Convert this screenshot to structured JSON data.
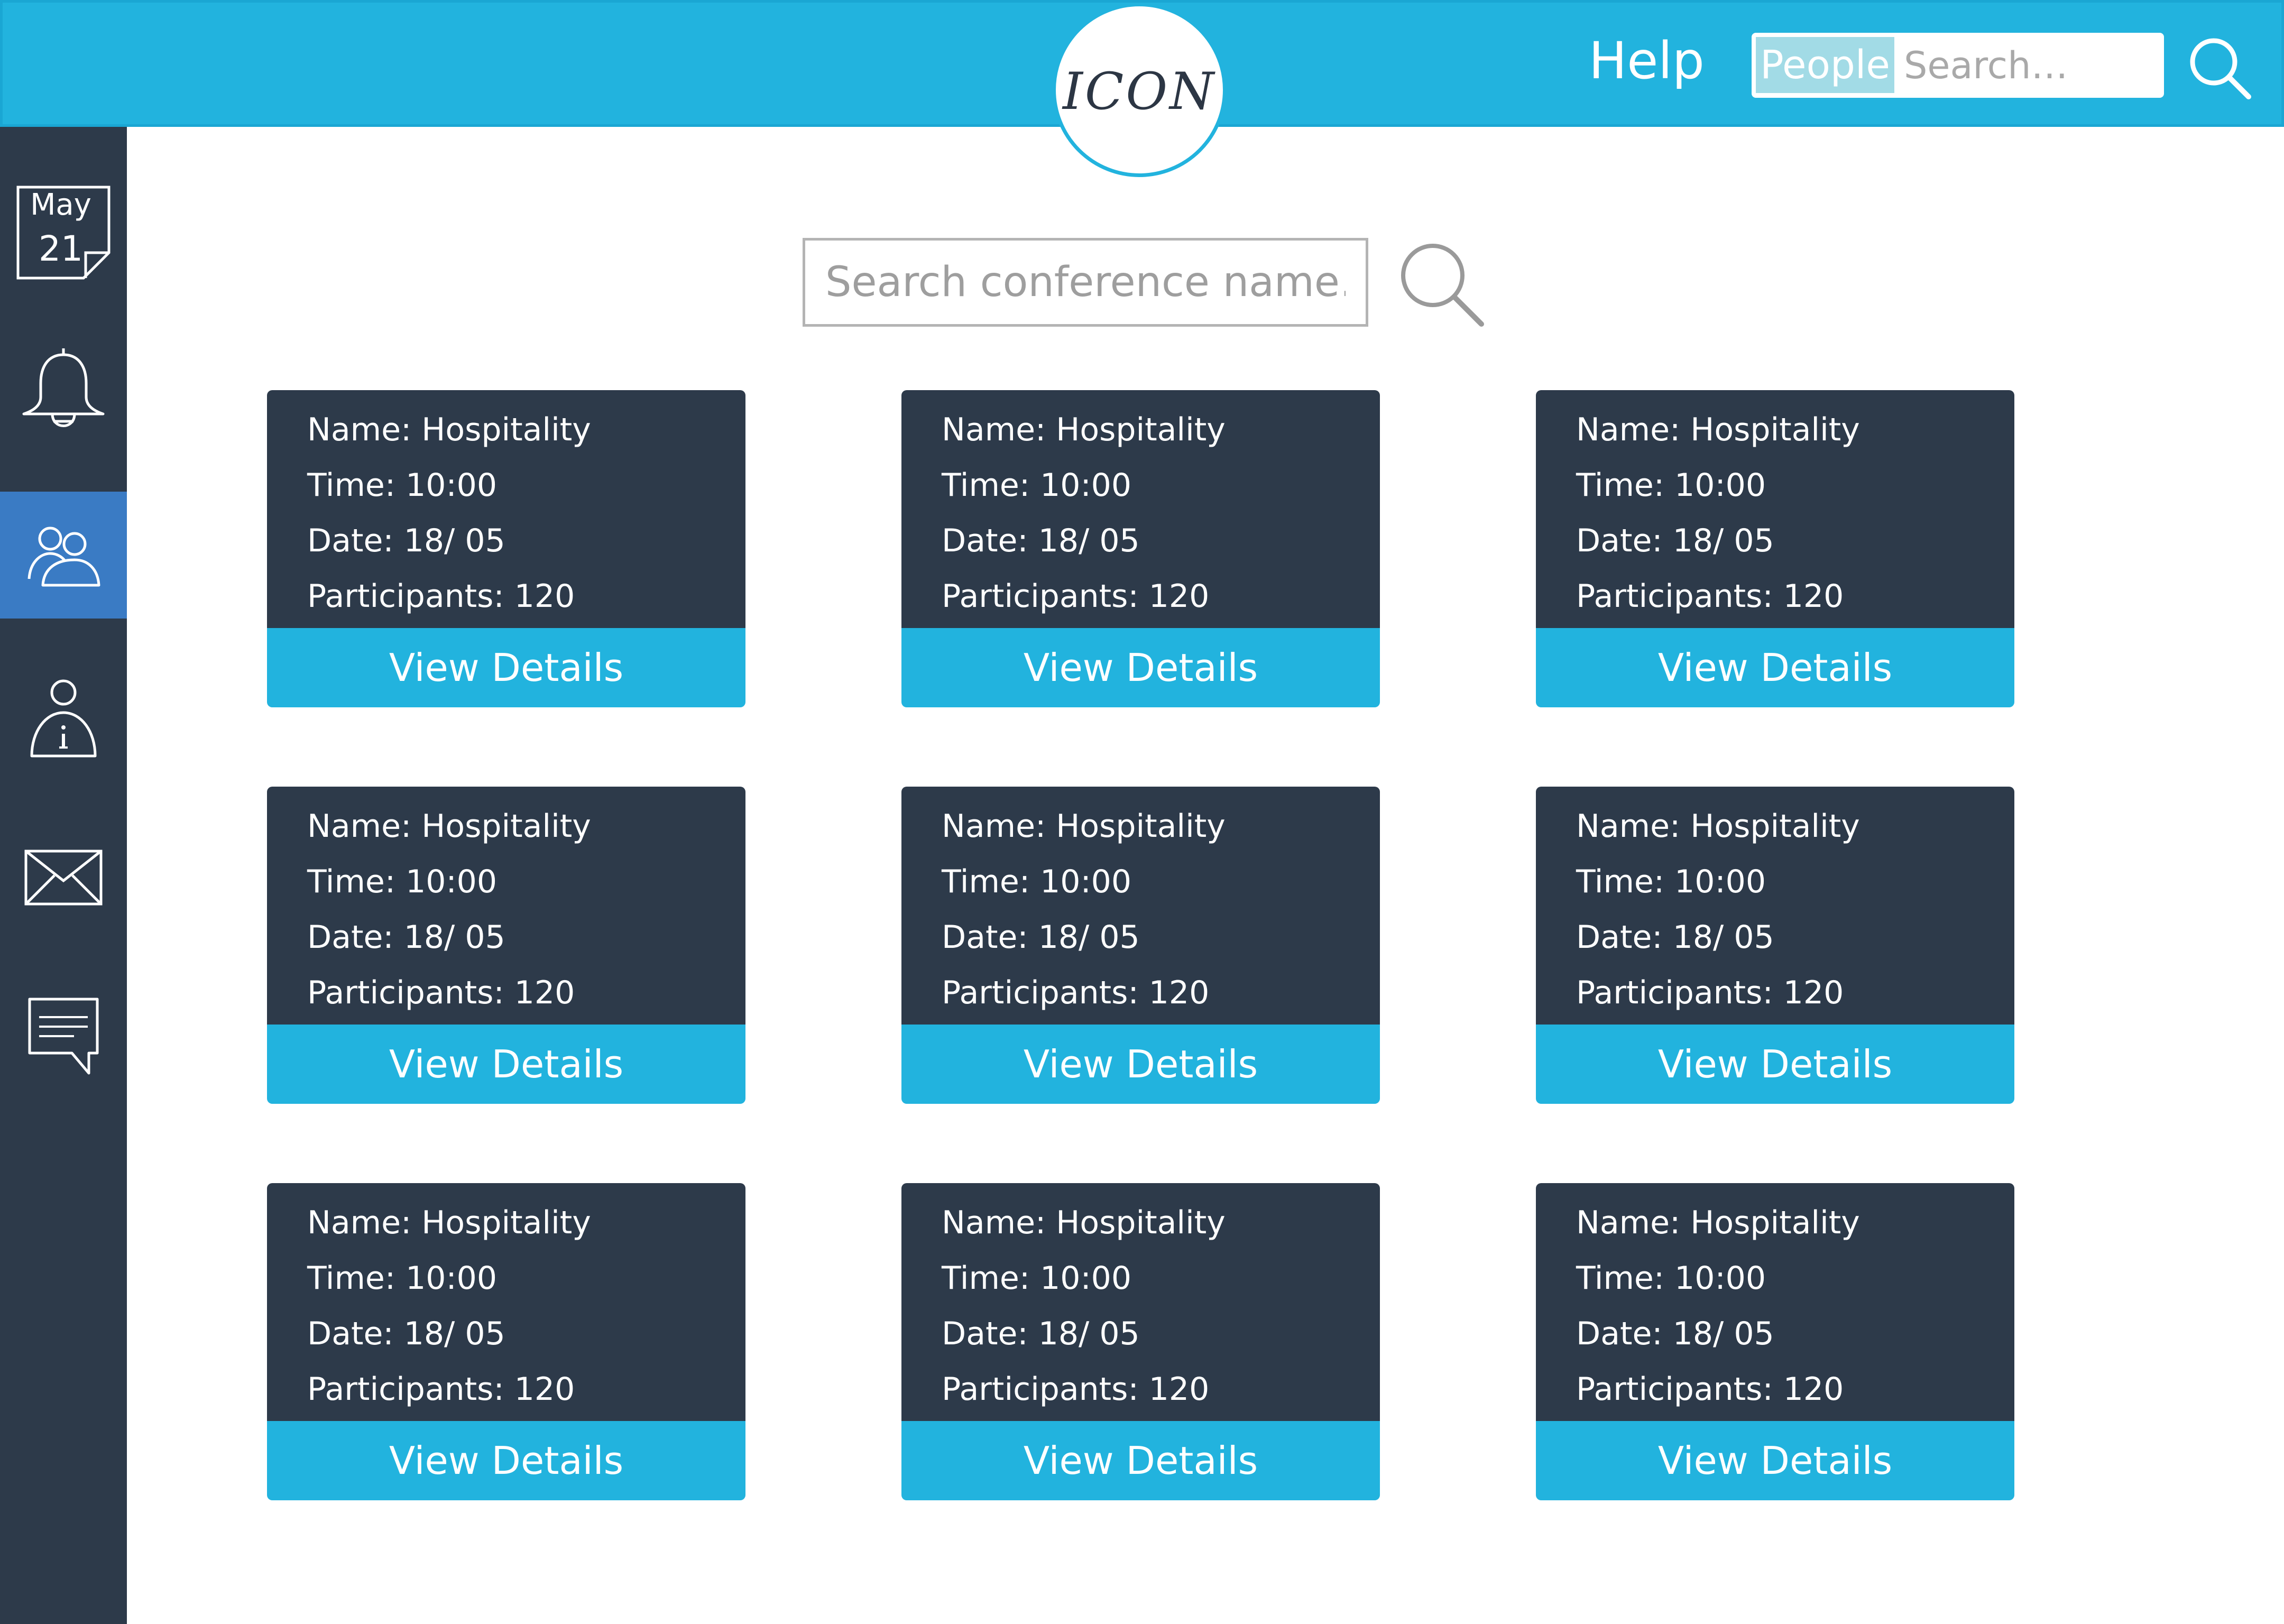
{
  "header": {
    "logo_text": "ICON",
    "help_label": "Help",
    "people_chip": "People",
    "search_placeholder": "Search…"
  },
  "sidebar": {
    "calendar": {
      "month": "May",
      "day": "21"
    },
    "items": [
      {
        "name": "calendar",
        "icon": "calendar-icon"
      },
      {
        "name": "notifications",
        "icon": "bell-icon"
      },
      {
        "name": "people",
        "icon": "people-icon",
        "active": true
      },
      {
        "name": "info",
        "icon": "user-info-icon"
      },
      {
        "name": "mail",
        "icon": "mail-icon"
      },
      {
        "name": "messages",
        "icon": "chat-icon"
      }
    ]
  },
  "main": {
    "conference_search_placeholder": "Search conference name…",
    "cards": [
      {
        "name": "Name: Hospitality",
        "time": "Time: 10:00",
        "date": "Date: 18/ 05",
        "participants": "Participants: 120",
        "button": "View Details"
      },
      {
        "name": "Name: Hospitality",
        "time": "Time: 10:00",
        "date": "Date: 18/ 05",
        "participants": "Participants: 120",
        "button": "View Details"
      },
      {
        "name": "Name: Hospitality",
        "time": "Time: 10:00",
        "date": "Date: 18/ 05",
        "participants": "Participants: 120",
        "button": "View Details"
      },
      {
        "name": "Name: Hospitality",
        "time": "Time: 10:00",
        "date": "Date: 18/ 05",
        "participants": "Participants: 120",
        "button": "View Details"
      },
      {
        "name": "Name: Hospitality",
        "time": "Time: 10:00",
        "date": "Date: 18/ 05",
        "participants": "Participants: 120",
        "button": "View Details"
      },
      {
        "name": "Name: Hospitality",
        "time": "Time: 10:00",
        "date": "Date: 18/ 05",
        "participants": "Participants: 120",
        "button": "View Details"
      },
      {
        "name": "Name: Hospitality",
        "time": "Time: 10:00",
        "date": "Date: 18/ 05",
        "participants": "Participants: 120",
        "button": "View Details"
      },
      {
        "name": "Name: Hospitality",
        "time": "Time: 10:00",
        "date": "Date: 18/ 05",
        "participants": "Participants: 120",
        "button": "View Details"
      },
      {
        "name": "Name: Hospitality",
        "time": "Time: 10:00",
        "date": "Date: 18/ 05",
        "participants": "Participants: 120",
        "button": "View Details"
      }
    ]
  },
  "colors": {
    "accent": "#22b3de",
    "dark": "#2d3a4a",
    "active_nav": "#3a7bc4",
    "chip": "#a2dbe6"
  }
}
